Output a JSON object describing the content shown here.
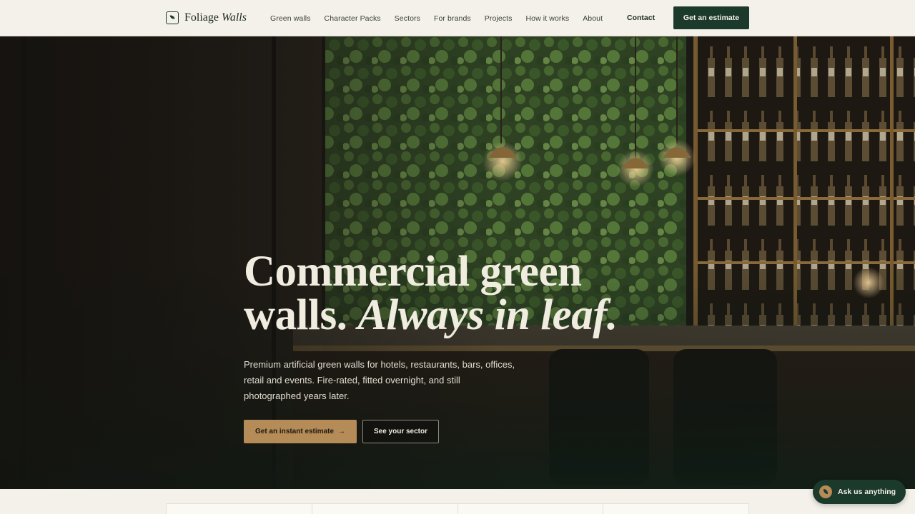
{
  "header": {
    "logo_word": "Foliage",
    "logo_word_italic": "Walls",
    "nav": [
      "Green walls",
      "Character Packs",
      "Sectors",
      "For brands",
      "Projects",
      "How it works",
      "About"
    ],
    "contact_label": "Contact",
    "cta_label": "Get an estimate"
  },
  "hero": {
    "title_line1": "Commercial green",
    "title_line2_plain": "walls.",
    "title_line2_italic": "Always in leaf.",
    "subtitle": "Premium artificial green walls for hotels, restaurants, bars, offices, retail and events. Fire-rated, fitted overnight, and still photographed years later.",
    "primary_cta": "Get an instant estimate",
    "primary_cta_arrow": "→",
    "secondary_cta": "See your sector"
  },
  "chat": {
    "label": "Ask us anything"
  },
  "colors": {
    "brand_green": "#1c3a2b",
    "accent_gold": "#b58b57",
    "background": "#f4f1ea"
  }
}
